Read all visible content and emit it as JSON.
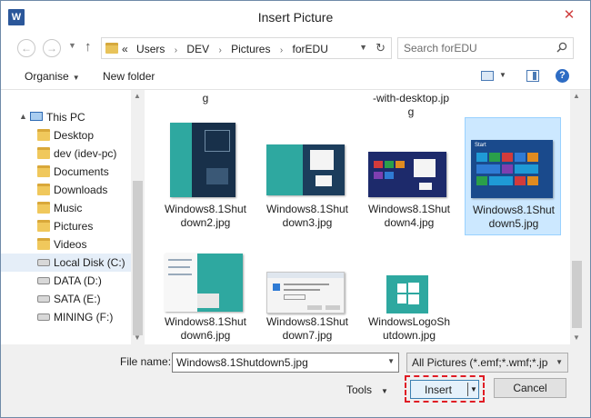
{
  "window": {
    "title": "Insert Picture",
    "app_icon": "W",
    "close_glyph": "✕"
  },
  "nav": {
    "back_glyph": "←",
    "forward_glyph": "→",
    "up_glyph": "↑",
    "breadcrumbs": [
      "«",
      "Users",
      "DEV",
      "Pictures",
      "forEDU"
    ],
    "refresh_glyph": "↻",
    "search_placeholder": "Search forEDU"
  },
  "toolbar": {
    "organise_label": "Organise",
    "new_folder_label": "New folder",
    "help_glyph": "?"
  },
  "sidebar": {
    "this_pc": "This PC",
    "items": [
      {
        "label": "Desktop",
        "icon": "folder-icon"
      },
      {
        "label": "dev (idev-pc)",
        "icon": "folder-icon"
      },
      {
        "label": "Documents",
        "icon": "folder-icon"
      },
      {
        "label": "Downloads",
        "icon": "folder-icon"
      },
      {
        "label": "Music",
        "icon": "folder-icon"
      },
      {
        "label": "Pictures",
        "icon": "folder-icon"
      },
      {
        "label": "Videos",
        "icon": "folder-icon"
      },
      {
        "label": "Local Disk (C:)",
        "icon": "disk-icon",
        "selected": true
      },
      {
        "label": "DATA (D:)",
        "icon": "disk-icon"
      },
      {
        "label": "SATA (E:)",
        "icon": "disk-icon"
      },
      {
        "label": "MINING (F:)",
        "icon": "disk-icon"
      }
    ]
  },
  "files": {
    "partial_row": [
      "g",
      "-with-desktop.jp\ng"
    ],
    "items": [
      {
        "name": "Windows8.1Shut\ndown2.jpg"
      },
      {
        "name": "Windows8.1Shut\ndown3.jpg"
      },
      {
        "name": "Windows8.1Shut\ndown4.jpg"
      },
      {
        "name": "Windows8.1Shut\ndown5.jpg",
        "selected": true
      },
      {
        "name": "Windows8.1Shut\ndown6.jpg"
      },
      {
        "name": "Windows8.1Shut\ndown7.jpg"
      },
      {
        "name": "WindowsLogoSh\nutdown.jpg"
      }
    ],
    "thumb_start_label": "Start"
  },
  "footer": {
    "file_name_label": "File name:",
    "file_name_value": "Windows8.1Shutdown5.jpg",
    "filter_value": "All Pictures (*.emf;*.wmf;*.jpg;*",
    "tools_label": "Tools",
    "insert_label": "Insert",
    "cancel_label": "Cancel"
  },
  "colors": {
    "teal": "#2ea8a0",
    "accent_blue": "#2b579a",
    "selection": "#cce8ff",
    "highlight_red": "#e01c24"
  }
}
